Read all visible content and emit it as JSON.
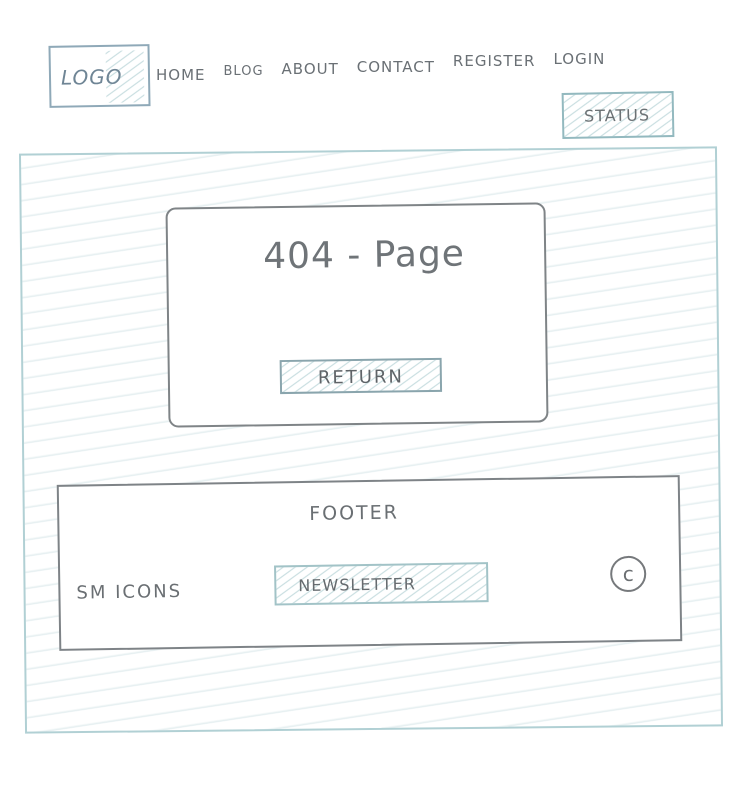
{
  "header": {
    "logo_label": "LOGO",
    "nav": [
      {
        "label": "HOME"
      },
      {
        "label": "BLOG"
      },
      {
        "label": "ABOUT"
      },
      {
        "label": "CONTACT"
      },
      {
        "label": "REGISTER"
      },
      {
        "label": "LOGIN"
      }
    ],
    "status_label": "STATUS"
  },
  "main": {
    "error_title": "404 - Page",
    "return_label": "RETURN"
  },
  "footer": {
    "title": "FOOTER",
    "social_label": "SM ICONS",
    "newsletter_label": "NEWSLETTER",
    "copyright_glyph": "c"
  },
  "colors": {
    "sketch_blue": "#b1d0d4",
    "pencil_gray": "#7e8387"
  },
  "icons": {
    "copyright": "copyright-icon"
  }
}
